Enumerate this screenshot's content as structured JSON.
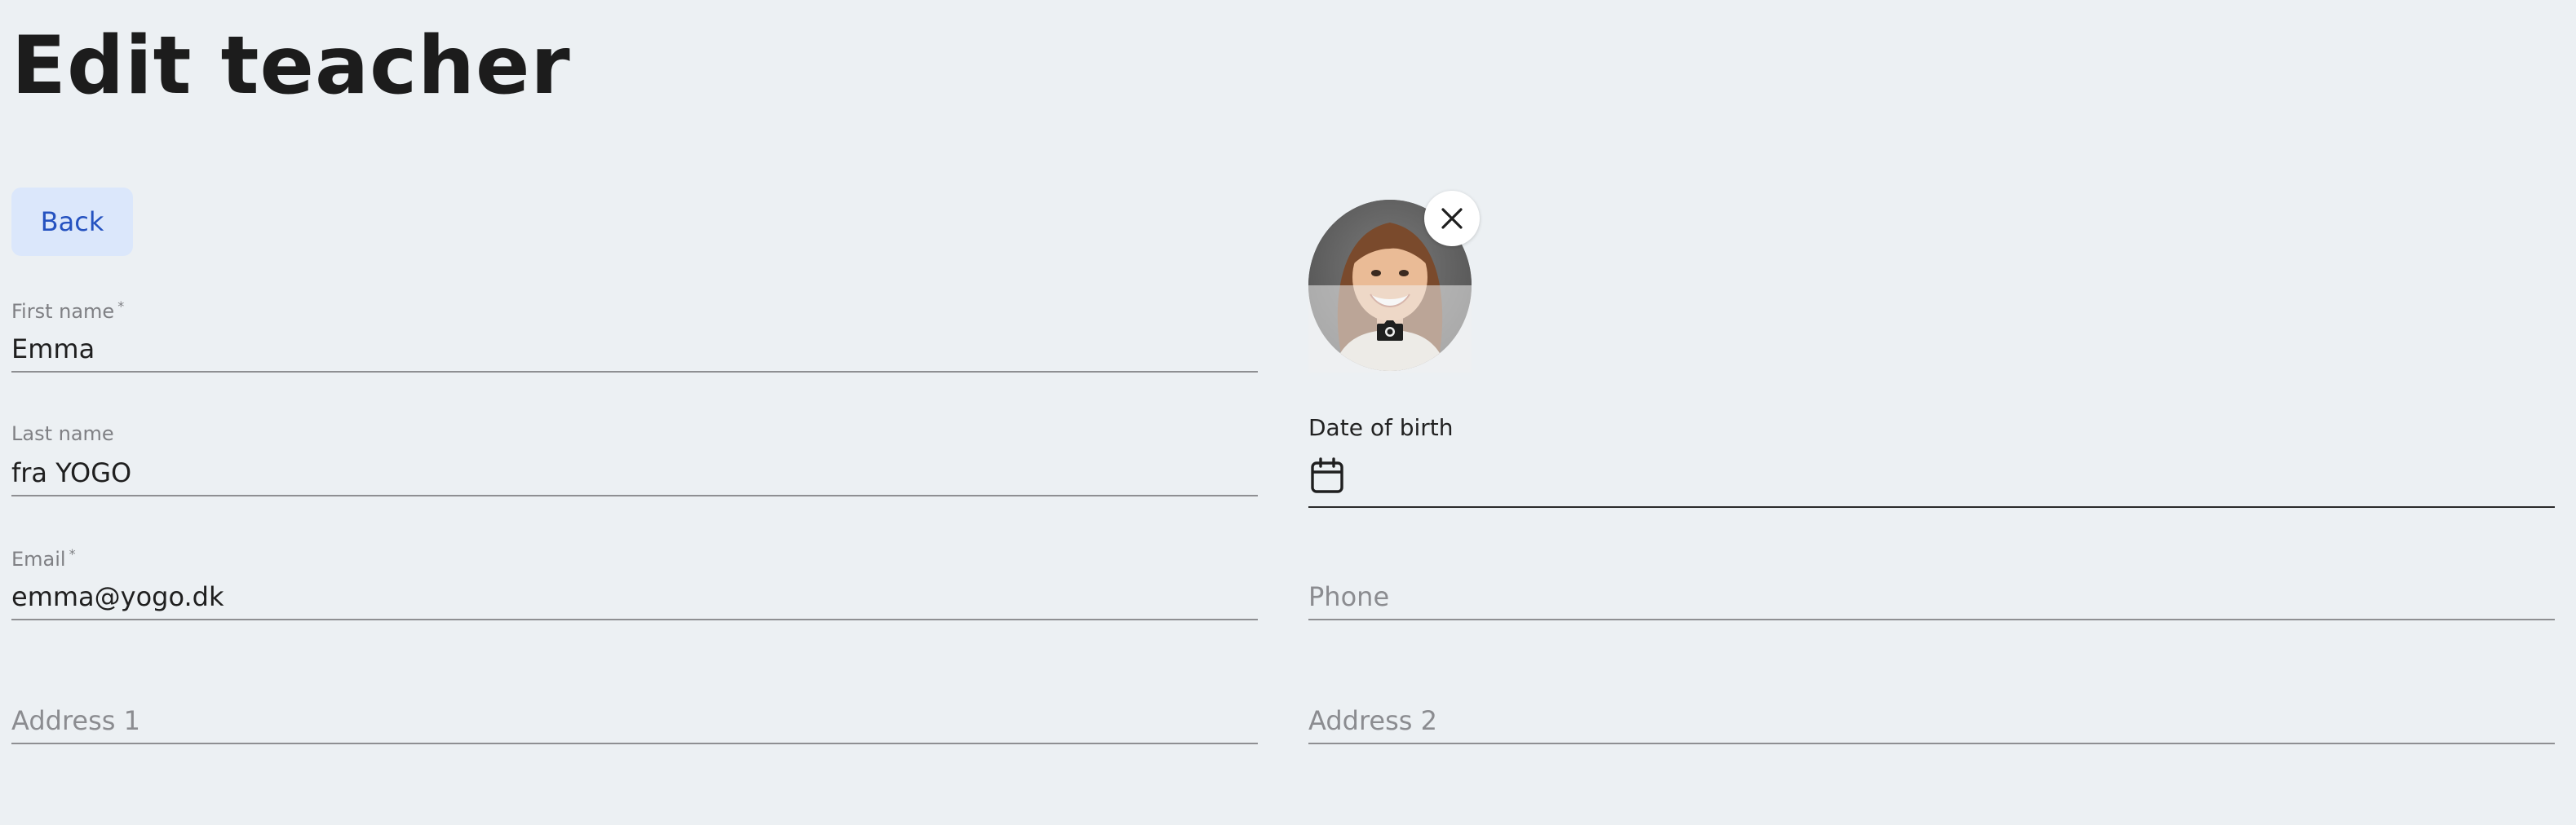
{
  "page": {
    "title": "Edit teacher"
  },
  "actions": {
    "back_label": "Back"
  },
  "form": {
    "first_name": {
      "label": "First name",
      "required": "*",
      "value": "Emma"
    },
    "last_name": {
      "label": "Last name",
      "value": "fra YOGO"
    },
    "email": {
      "label": "Email",
      "required": "*",
      "value": "emma@yogo.dk"
    },
    "address1": {
      "placeholder": "Address 1"
    },
    "date_of_birth": {
      "label": "Date of birth"
    },
    "phone": {
      "placeholder": "Phone"
    },
    "address2": {
      "placeholder": "Address 2"
    }
  },
  "icons": {
    "close": "close-icon",
    "camera": "camera-icon",
    "calendar": "calendar-icon"
  },
  "colors": {
    "background": "#ecf0f3",
    "back_button_bg": "#dbe7fb",
    "back_button_text": "#2552c0"
  }
}
